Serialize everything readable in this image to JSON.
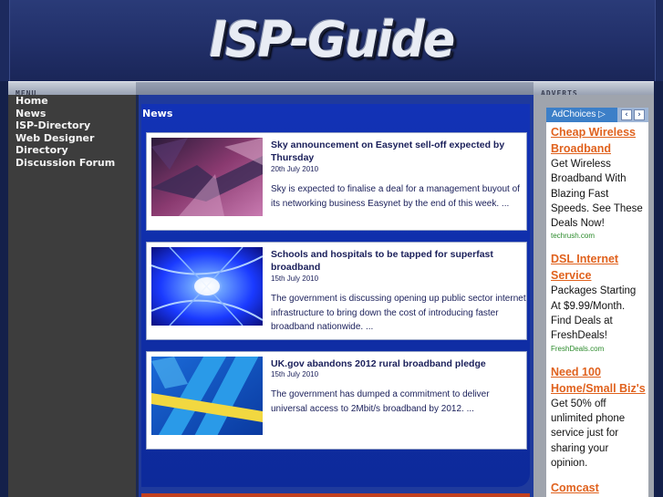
{
  "header": {
    "logo_text": "ISP-Guide"
  },
  "bars": {
    "menu_label": "MENU",
    "adverts_label": "ADVERTS"
  },
  "menu": {
    "items": [
      {
        "label": "Home"
      },
      {
        "label": "News"
      },
      {
        "label": "ISP-Directory"
      },
      {
        "label": "Web Designer"
      },
      {
        "label": "Directory"
      },
      {
        "label": "Discussion Forum"
      }
    ]
  },
  "news": {
    "heading": "News",
    "articles": [
      {
        "title": "Sky announcement on Easynet sell-off expected by Thursday",
        "date": "20th July 2010",
        "summary": "Sky is expected to finalise a deal for a management buyout of its networking business Easynet by the end of this week. ..."
      },
      {
        "title": "Schools and hospitals to be tapped for superfast broadband",
        "date": "15th July 2010",
        "summary": "The government is discussing opening up public sector internet infrastructure to bring down the cost of introducing faster broadband nationwide. ..."
      },
      {
        "title": "UK.gov abandons 2012 rural broadband pledge",
        "date": "15th July 2010",
        "summary": "The government has dumped a commitment to deliver universal access to 2Mbit/s broadband by 2012. ..."
      }
    ]
  },
  "ads": {
    "adchoices_label": "AdChoices",
    "items": [
      {
        "title": "Cheap Wireless Broadband",
        "body": "Get Wireless Broadband With Blazing Fast Speeds. See These Deals Now!",
        "domain": "techrush.com"
      },
      {
        "title": "DSL Internet Service",
        "body": "Packages Starting At $9.99/Month. Find Deals at FreshDeals!",
        "domain": "FreshDeals.com"
      },
      {
        "title": "Need 100 Home/Small Biz's",
        "body": "Get 50% off unlimited phone service just for sharing your opinion.",
        "domain": ""
      },
      {
        "title": "Comcast",
        "body": "",
        "domain": ""
      }
    ]
  },
  "colors": {
    "page_bg": "#14204a",
    "news_panel": "#1232b6",
    "ad_title": "#e0621e",
    "ad_domain": "#2a8a2a"
  }
}
